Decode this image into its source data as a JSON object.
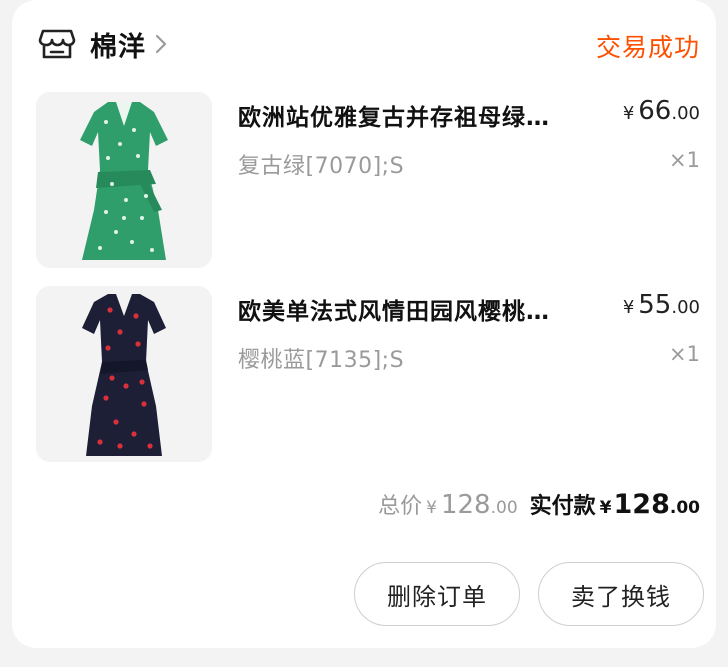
{
  "shop": {
    "name": "棉洋",
    "icon": "shop-icon"
  },
  "order": {
    "status": "交易成功",
    "status_color": "#ff5000"
  },
  "items": [
    {
      "title": "欧洲站优雅复古并存祖母绿…",
      "sku": "复古绿[7070];S",
      "price_symbol": "¥",
      "price_int": "66",
      "price_dec": ".00",
      "qty": "×1",
      "thumb_color": "#2f9e6a"
    },
    {
      "title": "欧美单法式风情田园风樱桃…",
      "sku": "樱桃蓝[7135];S",
      "price_symbol": "¥",
      "price_int": "55",
      "price_dec": ".00",
      "qty": "×1",
      "thumb_color": "#1c1f36"
    }
  ],
  "totals": {
    "total_label": "总价",
    "total_symbol": "¥",
    "total_int": "128",
    "total_dec": ".00",
    "paid_label": "实付款",
    "paid_symbol": "¥",
    "paid_int": "128",
    "paid_dec": ".00"
  },
  "actions": {
    "delete_label": "删除订单",
    "sell_label": "卖了换钱"
  }
}
